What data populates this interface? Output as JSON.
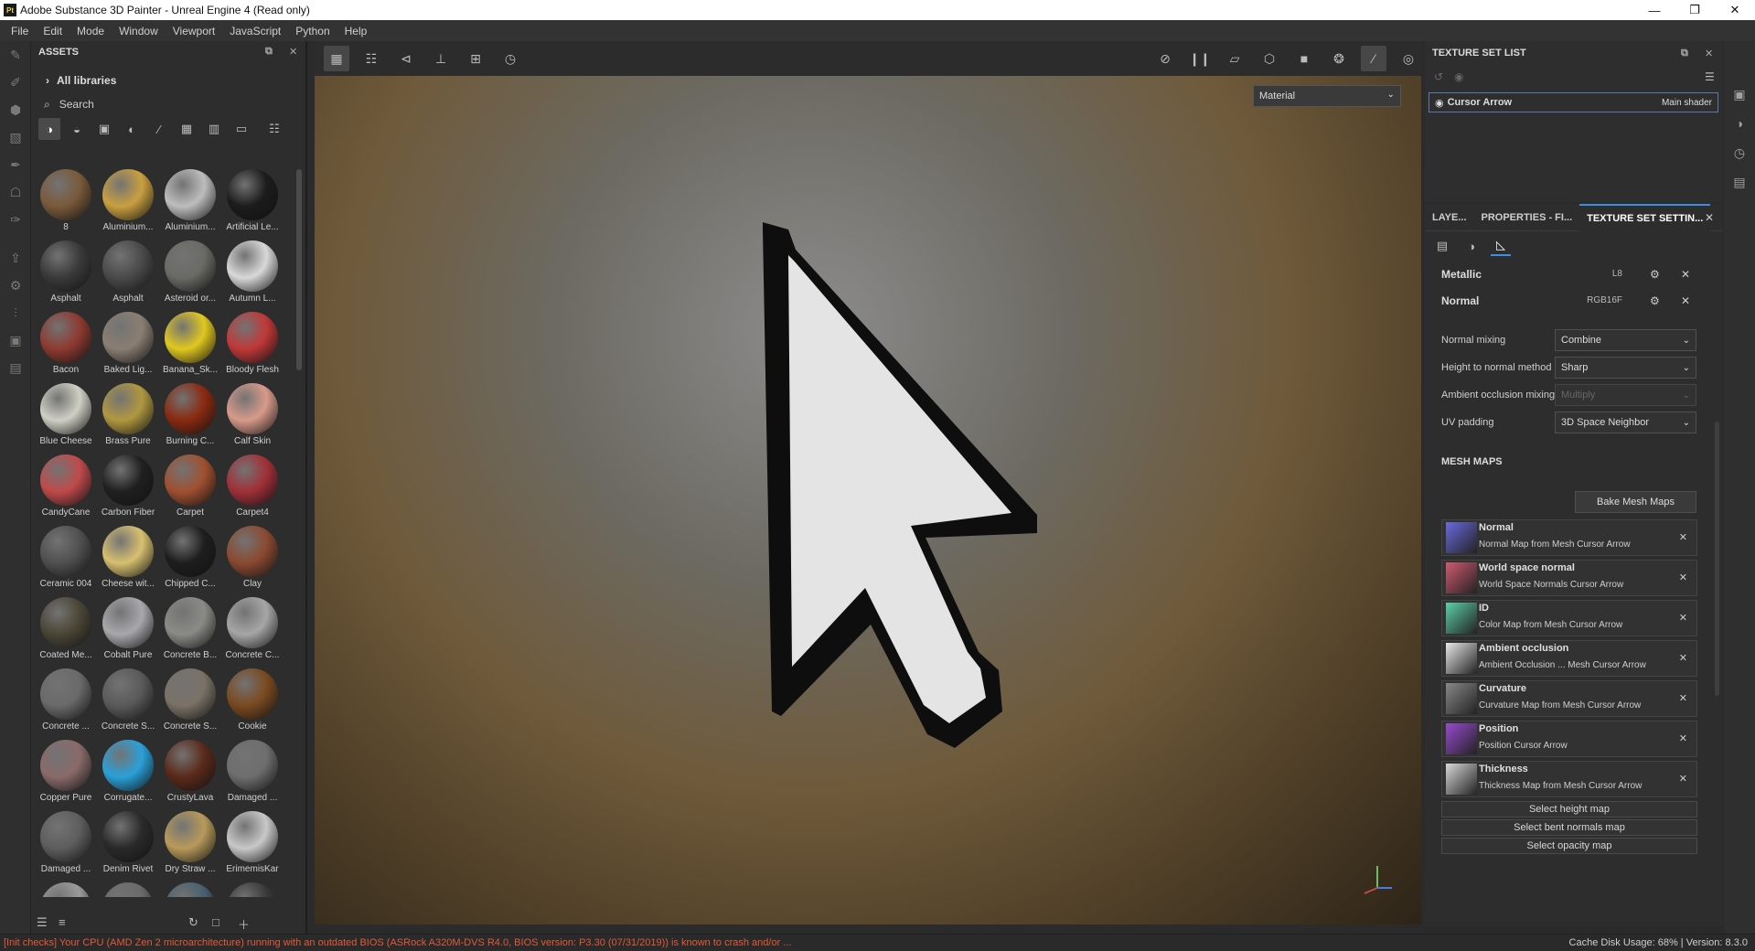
{
  "window": {
    "title": "Adobe Substance 3D Painter - Unreal Engine 4 (Read only)",
    "app_icon": "Pt"
  },
  "menu": [
    "File",
    "Edit",
    "Mode",
    "Window",
    "Viewport",
    "JavaScript",
    "Python",
    "Help"
  ],
  "assets": {
    "title": "ASSETS",
    "library": "All libraries",
    "search_placeholder": "Search",
    "tiles": [
      {
        "label": "8",
        "color": "#7a5a3a"
      },
      {
        "label": "Aluminium...",
        "color": "#c9a040"
      },
      {
        "label": "Aluminium...",
        "color": "#bdbdbd"
      },
      {
        "label": "Artificial Le...",
        "color": "#1c1c1c"
      },
      {
        "label": "Asphalt",
        "color": "#3a3a3a"
      },
      {
        "label": "Asphalt",
        "color": "#4a4a4a"
      },
      {
        "label": "Asteroid or...",
        "color": "#6a6a66"
      },
      {
        "label": "Autumn L...",
        "color": "#d8d8d8"
      },
      {
        "label": "Bacon",
        "color": "#8e3a30"
      },
      {
        "label": "Baked Lig...",
        "color": "#8a7e72"
      },
      {
        "label": "Banana_Sk...",
        "color": "#e0c820"
      },
      {
        "label": "Bloody Flesh",
        "color": "#c03838"
      },
      {
        "label": "Blue Cheese",
        "color": "#cfcfc4"
      },
      {
        "label": "Brass Pure",
        "color": "#b09840"
      },
      {
        "label": "Burning C...",
        "color": "#8a2a10"
      },
      {
        "label": "Calf Skin",
        "color": "#d89a8a"
      },
      {
        "label": "CandyCane",
        "color": "#c04a4a"
      },
      {
        "label": "Carbon Fiber",
        "color": "#202020"
      },
      {
        "label": "Carpet",
        "color": "#a05030"
      },
      {
        "label": "Carpet4",
        "color": "#a03038"
      },
      {
        "label": "Ceramic 004",
        "color": "#505050"
      },
      {
        "label": "Cheese wit...",
        "color": "#d8c070"
      },
      {
        "label": "Chipped C...",
        "color": "#1e1e1e"
      },
      {
        "label": "Clay",
        "color": "#8a4a30"
      },
      {
        "label": "Coated Me...",
        "color": "#4a4636"
      },
      {
        "label": "Cobalt Pure",
        "color": "#a8a8ac"
      },
      {
        "label": "Concrete B...",
        "color": "#8a8a86"
      },
      {
        "label": "Concrete C...",
        "color": "#a6a6a6"
      },
      {
        "label": "Concrete ...",
        "color": "#6a6a6a"
      },
      {
        "label": "Concrete S...",
        "color": "#5a5a5a"
      },
      {
        "label": "Concrete S...",
        "color": "#7a7266"
      },
      {
        "label": "Cookie",
        "color": "#7a4a20"
      },
      {
        "label": "Copper Pure",
        "color": "#8a6a6a"
      },
      {
        "label": "Corrugate...",
        "color": "#2aa0d8"
      },
      {
        "label": "CrustyLava",
        "color": "#5a2a1a"
      },
      {
        "label": "Damaged ...",
        "color": "#6e6e6e"
      },
      {
        "label": "Damaged ...",
        "color": "#5e5e5e"
      },
      {
        "label": "Denim Rivet",
        "color": "#2a2a2a"
      },
      {
        "label": "Dry Straw ...",
        "color": "#b89a5a"
      },
      {
        "label": "ErimemisKar",
        "color": "#c8c8c8"
      },
      {
        "label": "",
        "color": "#9a9a9a"
      },
      {
        "label": "",
        "color": "#6a6a6a"
      },
      {
        "label": "",
        "color": "#4a6070"
      },
      {
        "label": "",
        "color": "#3a3a3a"
      }
    ]
  },
  "viewport": {
    "mode": "Material"
  },
  "texture_set_list": {
    "title": "TEXTURE SET LIST",
    "item_name": "Cursor Arrow",
    "item_shader": "Main shader"
  },
  "settings": {
    "tabs": [
      "LAYE...",
      "PROPERTIES - FI...",
      "TEXTURE SET SETTIN..."
    ],
    "channels": [
      {
        "name": "Metallic",
        "format": "L8"
      },
      {
        "name": "Normal",
        "format": "RGB16F"
      }
    ],
    "props": [
      {
        "label": "Normal mixing",
        "value": "Combine",
        "disabled": false
      },
      {
        "label": "Height to normal method",
        "value": "Sharp",
        "disabled": false
      },
      {
        "label": "Ambient occlusion mixing",
        "value": "Multiply",
        "disabled": true
      },
      {
        "label": "UV padding",
        "value": "3D Space Neighbor",
        "disabled": false
      }
    ],
    "mesh_maps_title": "MESH MAPS",
    "bake_label": "Bake Mesh Maps",
    "maps": [
      {
        "title": "Normal",
        "sub": "Normal Map from Mesh Cursor Arrow",
        "color": "#6a6ae0"
      },
      {
        "title": "World space normal",
        "sub": "World Space Normals Cursor Arrow",
        "color": "#d05a70"
      },
      {
        "title": "ID",
        "sub": "Color Map from Mesh Cursor Arrow",
        "color": "#5ad0a8"
      },
      {
        "title": "Ambient occlusion",
        "sub": "Ambient Occlusion ... Mesh Cursor Arrow",
        "color": "#e8e8e8"
      },
      {
        "title": "Curvature",
        "sub": "Curvature Map from Mesh Cursor Arrow",
        "color": "#888888"
      },
      {
        "title": "Position",
        "sub": "Position Cursor Arrow",
        "color": "#9a4ad0"
      },
      {
        "title": "Thickness",
        "sub": "Thickness Map from Mesh Cursor Arrow",
        "color": "#d8d8d8"
      }
    ],
    "select_buttons": [
      "Select height map",
      "Select bent normals map",
      "Select opacity map"
    ]
  },
  "status": {
    "warning": "[Init checks] Your CPU (AMD Zen 2 microarchitecture) running with an outdated BIOS (ASRock A320M-DVS R4.0, BIOS version: P3.30 (07/31/2019)) is known to crash and/or ...",
    "right": "Cache Disk Usage:   68% | Version: 8.3.0"
  }
}
